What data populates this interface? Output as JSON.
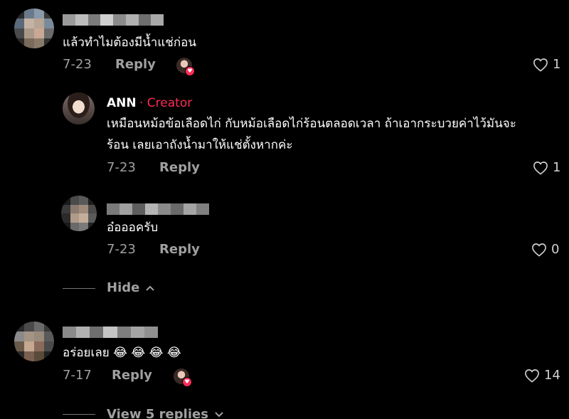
{
  "comments": [
    {
      "text": "แล้วทำไมต้องมีน้ำแช่ก่อน",
      "date": "7-23",
      "reply_label": "Reply",
      "likes": "1"
    },
    {
      "author": "ANN",
      "creator_tag": "· Creator",
      "text_lines": [
        "เหมือนหม้อข้อเลือดไก่ กับหม้อเลือดไก่ร้อนตลอดเวลา ถ้าเอากระบวยค่าไว้มันจะ",
        "ร้อน เลยเอาถังน้ำมาให้แช่ตั้งหากค่ะ"
      ],
      "date": "7-23",
      "reply_label": "Reply",
      "likes": "1"
    },
    {
      "text": "อ๋อออครับ",
      "date": "7-23",
      "reply_label": "Reply",
      "likes": "0"
    },
    {
      "text": "อร่อยเลย 😂 😂 😂 😂",
      "date": "7-17",
      "reply_label": "Reply",
      "likes": "14"
    }
  ],
  "hide_label": "Hide",
  "view_replies_label": "View 5 replies",
  "colors": {
    "background": "#000000",
    "creator_accent": "#fe2c55",
    "muted_text": "#a0a0a0"
  },
  "icons": {
    "like": "heart-outline-icon",
    "hide": "chevron-up-icon",
    "view": "chevron-down-icon"
  }
}
